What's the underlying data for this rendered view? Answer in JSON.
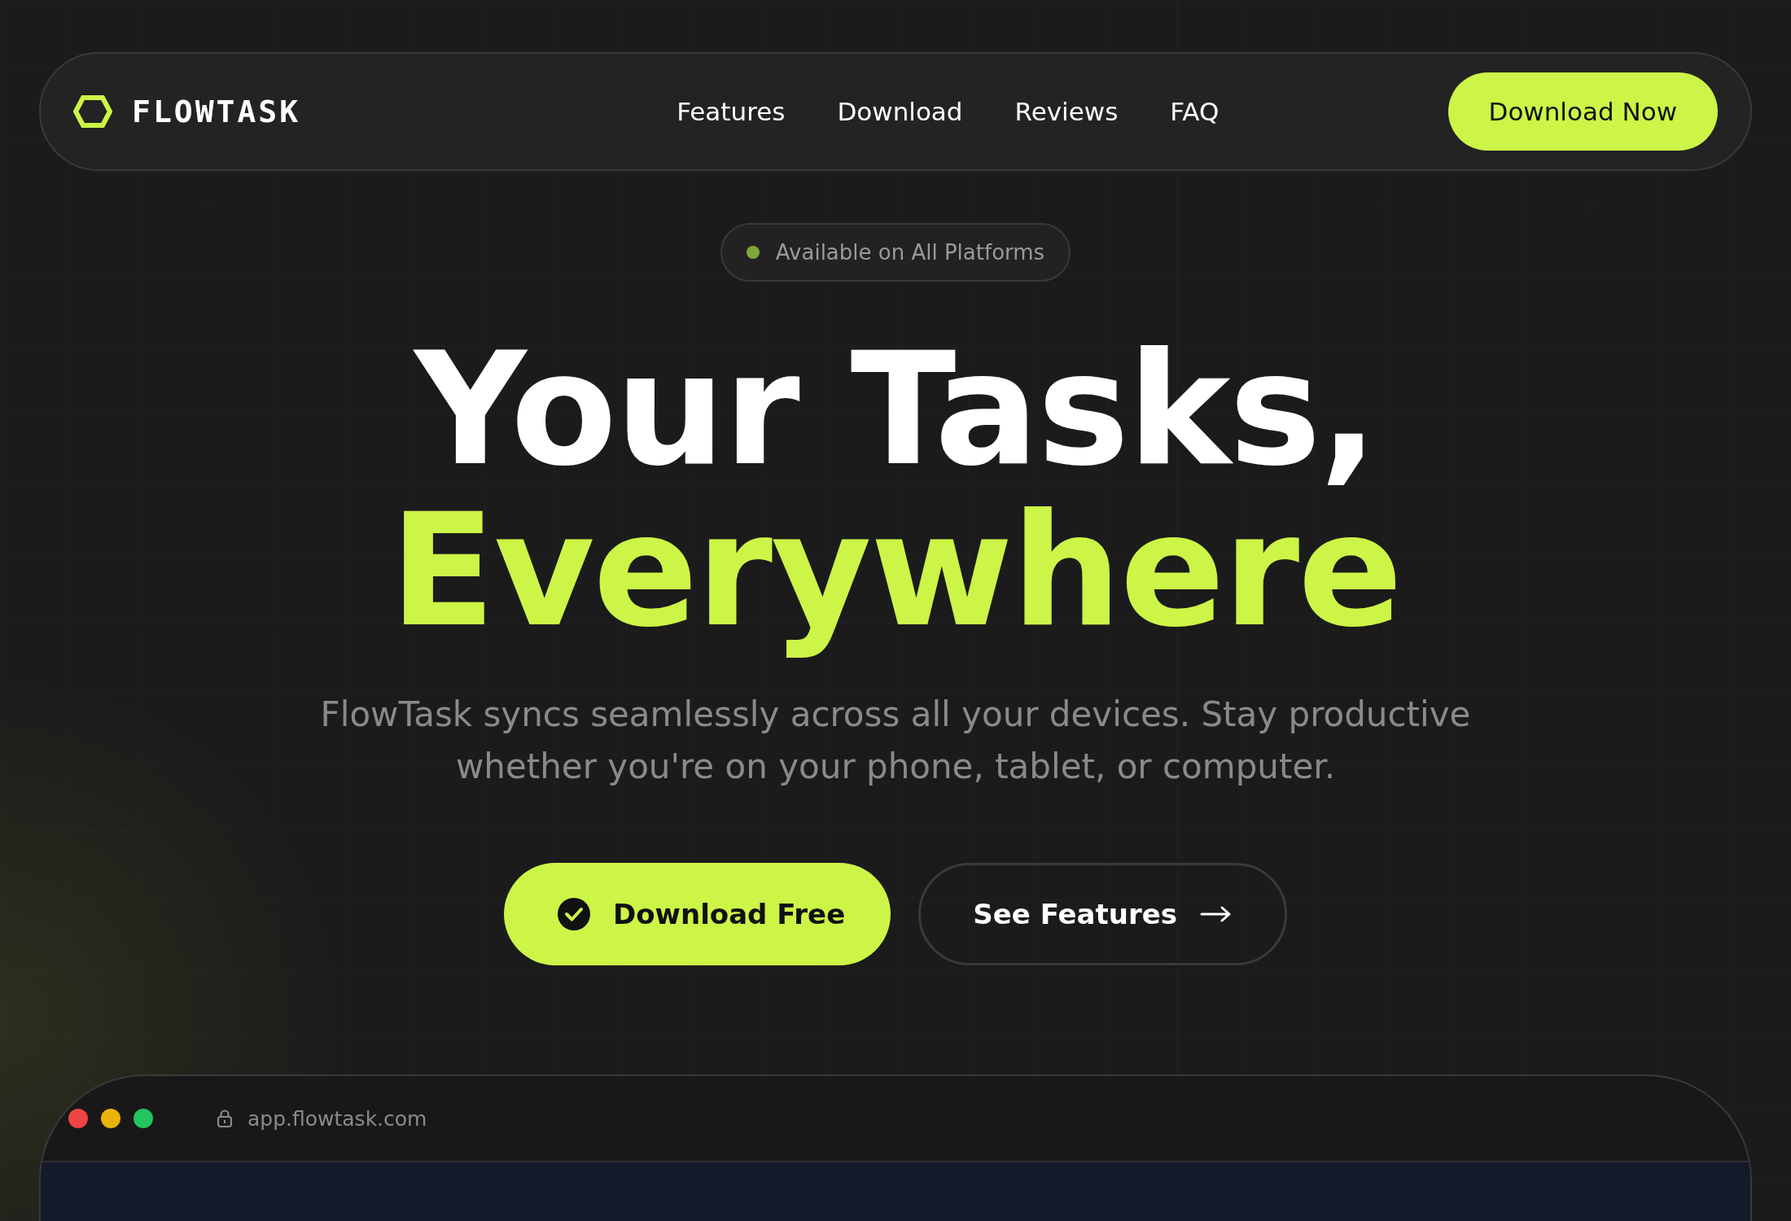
{
  "nav": {
    "brand": "FLOWTASK",
    "links": [
      "Features",
      "Download",
      "Reviews",
      "FAQ"
    ],
    "cta": "Download Now"
  },
  "hero": {
    "badge": {
      "text": "Available on All Platforms",
      "color": "#7fa83a"
    },
    "title_line_1": "Your Tasks,",
    "title_line_2": "Everywhere",
    "subtitle": "FlowTask syncs seamlessly across all your devices. Stay productive whether you're on your phone, tablet, or computer.",
    "primary_button": "Download Free",
    "secondary_button": "See Features"
  },
  "browser": {
    "dots": [
      {
        "color": "#ef4444"
      },
      {
        "color": "#eab308"
      },
      {
        "color": "#22c55e"
      }
    ],
    "url": "app.flowtask.com"
  }
}
